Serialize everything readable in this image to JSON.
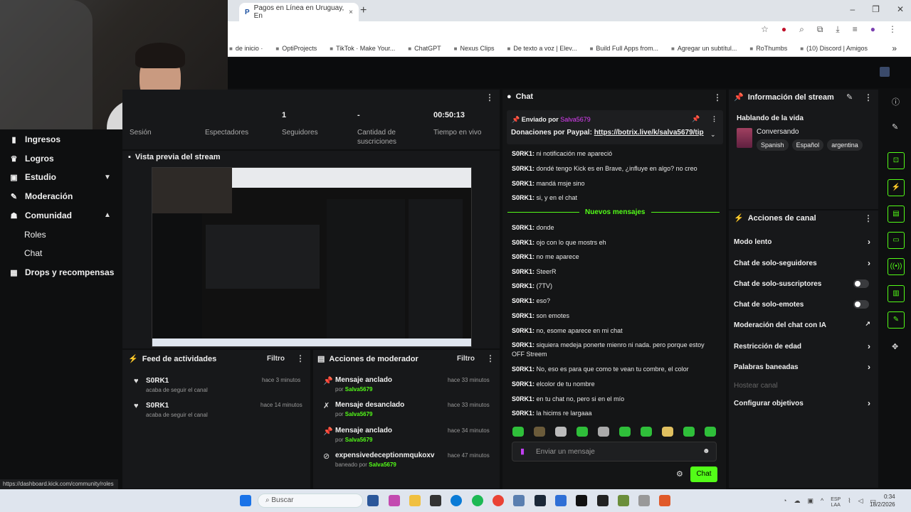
{
  "browser": {
    "tab_title": "Pagos en Línea en Uruguay, En",
    "tab_close": "×",
    "new_tab": "+",
    "window_controls": [
      "–",
      "❐",
      "✕"
    ],
    "bookmarks": [
      "de inicio ·",
      "OptiProjects",
      "TikTok · Make Your...",
      "ChatGPT",
      "Nexus Clips",
      "De texto a voz | Elev...",
      "Build Full Apps from...",
      "Agregar un subtítul...",
      "RoThumbs",
      "(10) Discord | Amigos"
    ],
    "bookmarks_more": "»"
  },
  "sidebar": {
    "items": [
      {
        "label": "Ingresos",
        "icon": "chart-icon"
      },
      {
        "label": "Logros",
        "icon": "trophy-icon"
      },
      {
        "label": "Estudio",
        "icon": "studio-icon"
      },
      {
        "label": "Moderación",
        "icon": "wrench-icon"
      },
      {
        "label": "Comunidad",
        "icon": "people-icon"
      },
      {
        "label": "Roles",
        "icon": ""
      },
      {
        "label": "Chat",
        "icon": ""
      },
      {
        "label": "Drops y recompensas",
        "icon": "gift-icon"
      }
    ],
    "status_url": "https://dashboard.kick.com/community/roles"
  },
  "stats": {
    "session_label": "Sesión",
    "viewers_label": "Espectadores",
    "followers_value": "1",
    "followers_label": "Seguidores",
    "subs_value": "-",
    "subs_label": "Cantidad de suscriciones",
    "time_value": "00:50:13",
    "time_label": "Tiempo en vivo"
  },
  "preview": {
    "title": "Vista previa del stream"
  },
  "activity_feed": {
    "title": "Feed de actividades",
    "filter": "Filtro",
    "items": [
      {
        "user": "S0RK1",
        "text": "acaba de seguir el canal",
        "time": "hace 3 minutos"
      },
      {
        "user": "S0RK1",
        "text": "acaba de seguir el canal",
        "time": "hace 14 minutos"
      }
    ]
  },
  "mod_actions": {
    "title": "Acciones de moderador",
    "filter": "Filtro",
    "items": [
      {
        "title": "Mensaje anclado",
        "prefix": "por",
        "by": "Salva5679",
        "time": "hace 33 minutos"
      },
      {
        "title": "Mensaje desanclado",
        "prefix": "por",
        "by": "Salva5679",
        "time": "hace 33 minutos"
      },
      {
        "title": "Mensaje anclado",
        "prefix": "por",
        "by": "Salva5679",
        "time": "hace 34 minutos"
      },
      {
        "title": "expensivedeceptionmqukoxv",
        "prefix": "baneado por",
        "by": "Salva5679",
        "time": "hace 47 minutos"
      }
    ]
  },
  "chat": {
    "title": "Chat",
    "pinned_by_label": "Enviado por",
    "pinned_by": "Salva5679",
    "pinned_text": "Donaciones por Paypal:",
    "pinned_link": "https://botrix.live/k/salva5679/tip",
    "new_messages_label": "Nuevos mensajes",
    "messages_before": [
      {
        "user": "S0RK1:",
        "text": "ni notificación me apareció"
      },
      {
        "user": "S0RK1:",
        "text": "dondé tengo Kick es en Brave, ¿influye en algo? no creo"
      },
      {
        "user": "S0RK1:",
        "text": "mandá msje sino"
      },
      {
        "user": "S0RK1:",
        "text": "si, y en el chat"
      }
    ],
    "messages_after": [
      {
        "user": "S0RK1:",
        "text": "donde"
      },
      {
        "user": "S0RK1:",
        "text": "ojo con lo que mostrs eh"
      },
      {
        "user": "S0RK1:",
        "text": "no me aparece"
      },
      {
        "user": "S0RK1:",
        "text": "SteerR"
      },
      {
        "user": "S0RK1:",
        "text": "(7TV)"
      },
      {
        "user": "S0RK1:",
        "text": "eso?"
      },
      {
        "user": "S0RK1:",
        "text": "son emotes"
      },
      {
        "user": "S0RK1:",
        "text": "no, esome aparece en mi chat"
      },
      {
        "user": "S0RK1:",
        "text": "siquiera medeja ponerte mienro ni nada. pero porque estoy OFF Streem"
      },
      {
        "user": "S0RK1:",
        "text": "No, eso es para que como te vean tu combre, el color"
      },
      {
        "user": "S0RK1:",
        "text": "elcolor de tu nombre"
      },
      {
        "user": "S0RK1:",
        "text": "en tu chat no, pero si en el mío"
      },
      {
        "user": "S0RK1:",
        "text": "la hicims re largaaa"
      }
    ],
    "input_placeholder": "Enviar un mensaje",
    "send_label": "Chat"
  },
  "stream_info": {
    "title": "Información del stream",
    "stream_title": "Hablando de la vida",
    "category": "Conversando",
    "tags": [
      "Spanish",
      "Español",
      "argentina"
    ]
  },
  "channel_actions": {
    "title": "Acciones de canal",
    "items": [
      {
        "label": "Modo lento",
        "control": "arrow"
      },
      {
        "label": "Chat de solo-seguidores",
        "control": "arrow"
      },
      {
        "label": "Chat de solo-suscriptores",
        "control": "toggle"
      },
      {
        "label": "Chat de solo-emotes",
        "control": "toggle"
      },
      {
        "label": "Moderación del chat con IA",
        "control": "external"
      },
      {
        "label": "Restricción de edad",
        "control": "arrow"
      },
      {
        "label": "Palabras baneadas",
        "control": "arrow"
      },
      {
        "label": "Hostear canal",
        "control": "none"
      },
      {
        "label": "Configurar objetivos",
        "control": "arrow"
      }
    ]
  },
  "taskbar": {
    "search_label": "Buscar",
    "lang": "ESP",
    "region": "LAA",
    "time": "0:34",
    "date": "18/2/2026"
  },
  "colors": {
    "accent": "#53fc18",
    "pinned_user": "#e040fb"
  }
}
